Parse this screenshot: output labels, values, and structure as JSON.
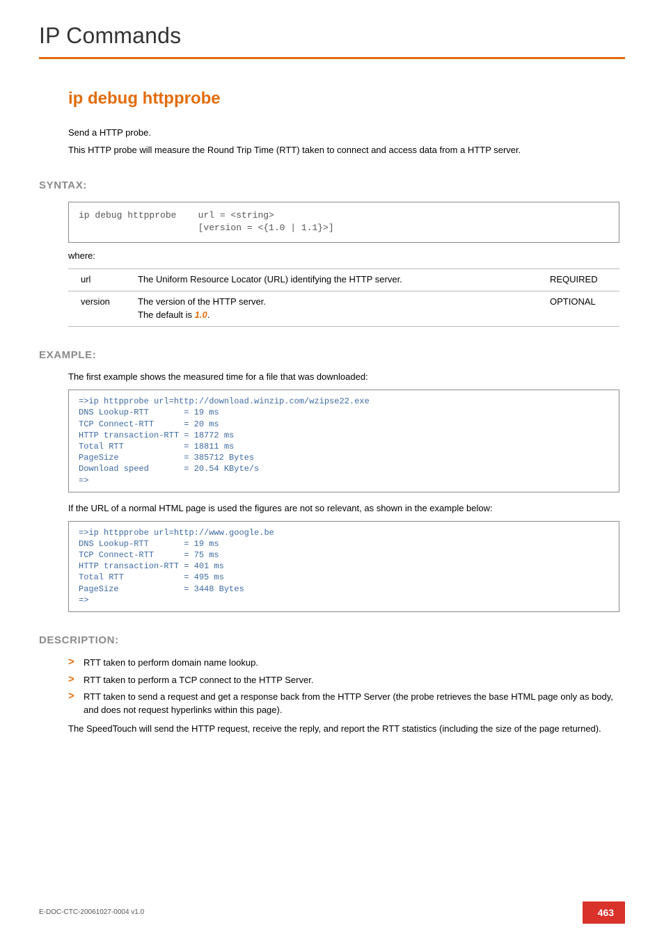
{
  "header": {
    "title": "IP Commands"
  },
  "command": {
    "title": "ip debug httpprobe"
  },
  "intro": {
    "line1": "Send a HTTP probe.",
    "line2": "This HTTP probe will measure the Round Trip Time (RTT) taken to connect and access data from a HTTP server."
  },
  "syntax": {
    "label": "SYNTAX:",
    "code": "ip debug httpprobe    url = <string>\n                      [version = <{1.0 | 1.1}>]",
    "where": "where:",
    "params": [
      {
        "name": "url",
        "desc": "The Uniform Resource Locator (URL) identifying the HTTP server.",
        "req": "REQUIRED",
        "default_prefix": "",
        "default_value": ""
      },
      {
        "name": "version",
        "desc": "The version of the HTTP server.",
        "req": "OPTIONAL",
        "default_prefix": "The default is ",
        "default_value": "1.0",
        "default_suffix": "."
      }
    ]
  },
  "example": {
    "label": "EXAMPLE:",
    "intro1": "The first example shows the measured time for a file that was downloaded:",
    "code1": "=>ip httpprobe url=http://download.winzip.com/wzipse22.exe\nDNS Lookup-RTT       = 19 ms\nTCP Connect-RTT      = 20 ms\nHTTP transaction-RTT = 18772 ms\nTotal RTT            = 18811 ms\nPageSize             = 385712 Bytes\nDownload speed       = 20.54 KByte/s\n=>",
    "intro2": "If the URL of a normal HTML page is used the figures are not so relevant, as shown in the example below:",
    "code2": "=>ip httpprobe url=http://www.google.be\nDNS Lookup-RTT       = 19 ms\nTCP Connect-RTT      = 75 ms\nHTTP transaction-RTT = 401 ms\nTotal RTT            = 495 ms\nPageSize             = 3448 Bytes\n=>"
  },
  "description": {
    "label": "DESCRIPTION:",
    "items": [
      "RTT taken to perform domain name lookup.",
      "RTT taken to perform a TCP connect to the HTTP Server.",
      "RTT taken to send a request and get a response back from the HTTP Server (the probe retrieves the base HTML page only as body, and does not request hyperlinks within this page)."
    ],
    "paragraph": "The SpeedTouch will send the HTTP request, receive the reply, and report the RTT statistics (including the size of the page returned)."
  },
  "footer": {
    "docid": "E-DOC-CTC-20061027-0004 v1.0",
    "page": "463"
  },
  "glyphs": {
    "chevron": ">"
  }
}
